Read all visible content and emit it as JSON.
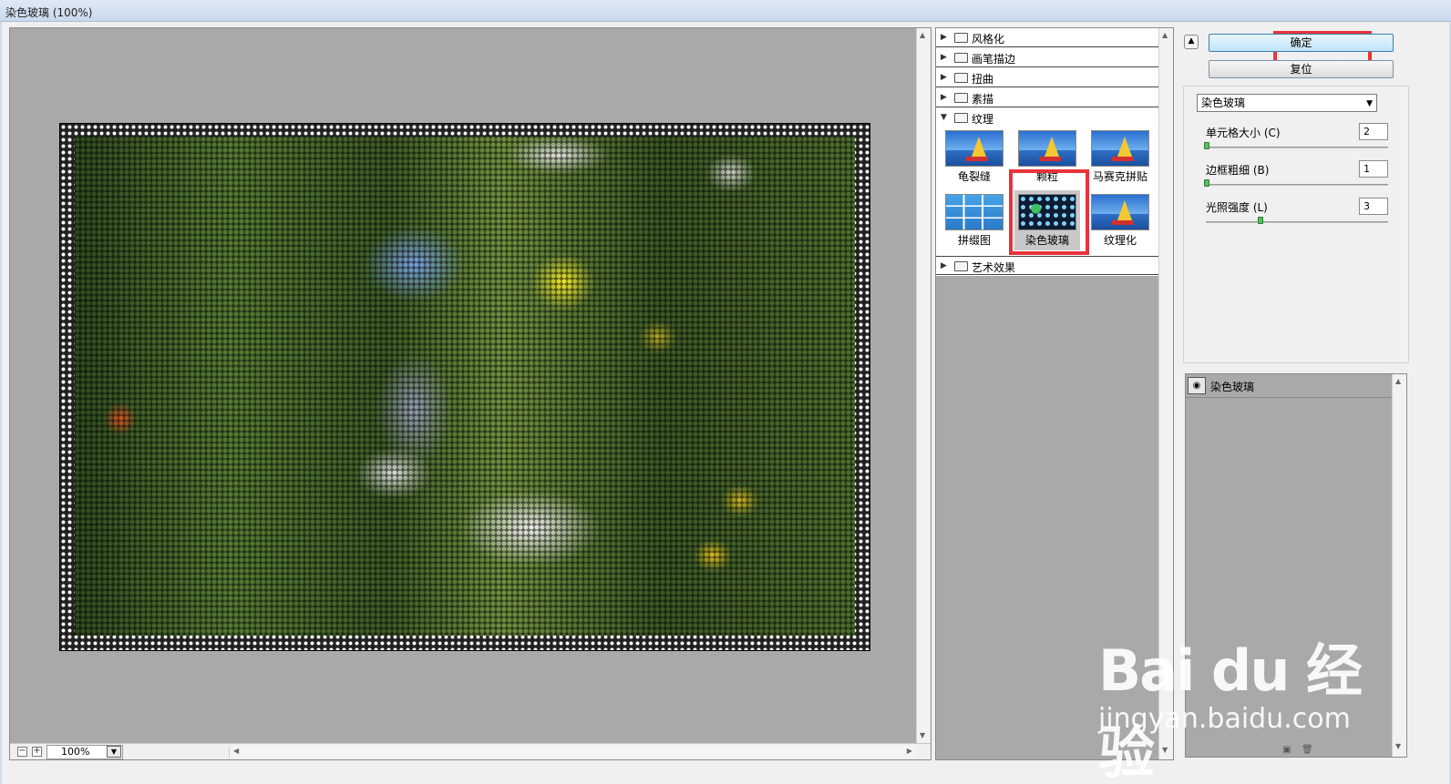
{
  "window": {
    "title": "染色玻璃 (100%)"
  },
  "preview": {
    "zoom_value": "100%",
    "zoom_out": "−",
    "zoom_in": "+"
  },
  "filter_categories": [
    {
      "label": "风格化",
      "expanded": false
    },
    {
      "label": "画笔描边",
      "expanded": false
    },
    {
      "label": "扭曲",
      "expanded": false
    },
    {
      "label": "素描",
      "expanded": false
    },
    {
      "label": "纹理",
      "expanded": true
    },
    {
      "label": "艺术效果",
      "expanded": false
    }
  ],
  "texture_filters": [
    {
      "label": "龟裂缝"
    },
    {
      "label": "颗粒"
    },
    {
      "label": "马赛克拼贴"
    },
    {
      "label": "拼缀图"
    },
    {
      "label": "染色玻璃",
      "selected": true
    },
    {
      "label": "纹理化"
    }
  ],
  "buttons": {
    "ok": "确定",
    "reset": "复位"
  },
  "settings": {
    "selected_filter": "染色玻璃",
    "params": [
      {
        "label": "单元格大小 (C)",
        "value": "2",
        "slider_fraction": 0.0
      },
      {
        "label": "边框粗细 (B)",
        "value": "1",
        "slider_fraction": 0.0
      },
      {
        "label": "光照强度 (L)",
        "value": "3",
        "slider_fraction": 0.3
      }
    ]
  },
  "layers": [
    {
      "name": "染色玻璃",
      "visible": true
    }
  ],
  "watermark": {
    "brand": "Bai du 经验",
    "url": "jingyan.baidu.com"
  },
  "colors": {
    "highlight": "#e8333a",
    "ok_button": "#bfe4f7",
    "slider_knob": "#5ac060"
  },
  "icons": {
    "expand": "triangle-right-icon",
    "collapse": "triangle-down-icon",
    "folder": "folder-icon",
    "eye": "eye-icon"
  }
}
